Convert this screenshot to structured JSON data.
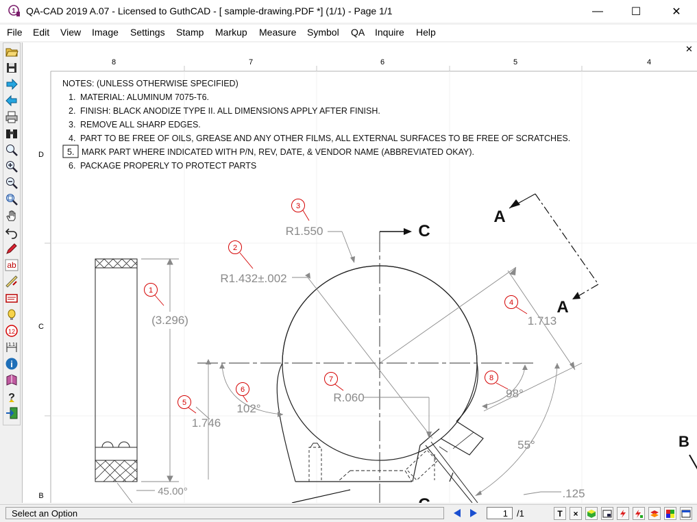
{
  "window": {
    "title": "QA-CAD 2019 A.07 - Licensed to GuthCAD  -  [ sample-drawing.PDF *] (1/1)  -  Page 1/1",
    "minimize": "—",
    "maximize": "☐",
    "close": "✕"
  },
  "menu": [
    "File",
    "Edit",
    "View",
    "Image",
    "Settings",
    "Stamp",
    "Markup",
    "Measure",
    "Symbol",
    "QA",
    "Inquire",
    "Help"
  ],
  "toolbar_icons": [
    "open-file-icon",
    "save-icon",
    "forward-arrow-icon",
    "back-arrow-icon",
    "print-icon",
    "binoculars-icon",
    "zoom-icon",
    "zoom-in-icon",
    "zoom-out-icon",
    "zoom-window-icon",
    "pan-hand-icon",
    "undo-icon",
    "pencil-icon",
    "text-ab-icon",
    "ruler-edit-icon",
    "stamp-note-icon",
    "balloon-light-icon",
    "balloon-number-icon",
    "dimension-icon",
    "info-icon",
    "book-icon",
    "help-icon",
    "exit-icon"
  ],
  "canvas": {
    "close": "✕"
  },
  "drawing": {
    "border_cols": [
      "8",
      "7",
      "6",
      "5",
      "4"
    ],
    "border_rows": [
      "D",
      "C",
      "B"
    ],
    "notes_title": "NOTES: (UNLESS OTHERWISE SPECIFIED)",
    "notes": [
      {
        "num": "1.",
        "text": "MATERIAL: ALUMINUM   7075-T6."
      },
      {
        "num": "2.",
        "text": "FINISH: BLACK ANODIZE TYPE II. ALL DIMENSIONS APPLY AFTER FINISH."
      },
      {
        "num": "3.",
        "text": "REMOVE ALL SHARP EDGES."
      },
      {
        "num": "4.",
        "text": "PART TO BE FREE OF OILS, GREASE AND ANY OTHER FILMS, ALL EXTERNAL SURFACES TO BE FREE OF SCRATCHES."
      },
      {
        "num": "5.",
        "text": "MARK PART WHERE INDICATED WITH P/N, REV, DATE, & VENDOR NAME (ABBREVIATED OKAY)."
      },
      {
        "num": "6.",
        "text": "PACKAGE PROPERLY TO PROTECT PARTS"
      }
    ],
    "dimensions": {
      "r1550": "R1.550",
      "r1432": "R1.432±.002",
      "d3296": "(3.296)",
      "d1713": "1.713",
      "d1746": "1.746",
      "a102": "102°",
      "r060": "R.060",
      "a98": "98°",
      "a55": "55°",
      "a45": "45.00°",
      "d125": ".125"
    },
    "section_labels": {
      "a_top": "A",
      "a_bottom": "A",
      "c_top": "C",
      "c_bottom": "C",
      "b": "B"
    },
    "balloons": [
      "1",
      "2",
      "3",
      "4",
      "5",
      "6",
      "7",
      "8"
    ]
  },
  "status": {
    "message": "Select an Option",
    "page": "1",
    "total": "/1",
    "buttons": [
      "T",
      "×",
      "cube",
      "frame",
      "lightning",
      "lightning2",
      "layers",
      "palette",
      "window"
    ]
  },
  "colors": {
    "balloon": "#d40000",
    "dim": "#8a8a8a"
  }
}
